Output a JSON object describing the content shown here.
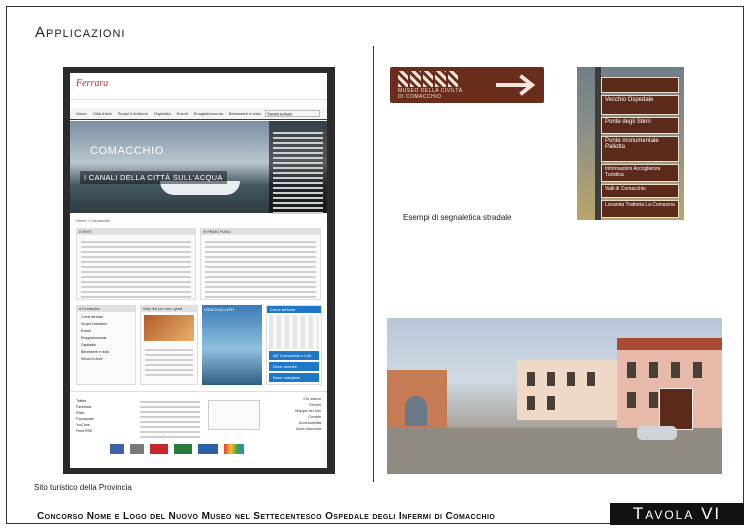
{
  "section_title": "Applicazioni",
  "captions": {
    "left": "Sito turistico della Provincia",
    "right": "Esempi di segnaletica stradale"
  },
  "footer": {
    "competition": "Concorso Nome e Logo del Nuovo Museo nel Settecentesco Ospedale degli Infermi di Comacchio",
    "board": "Tavola VI"
  },
  "sign_brown": {
    "text_line1": "MUSEO DELLA CIVILTÀ",
    "text_line2": "DI COMACCHIO"
  },
  "street_signs": [
    "Vecchio Ospedale",
    "Ponte degli Sbirri",
    "Ponte monumentale Pallotta",
    "Informazioni Accoglienza Turistica",
    "Valli di Comacchio",
    "Locanda Trattoria La Comacina"
  ],
  "website": {
    "logo": "Ferrara",
    "nav": [
      "Home",
      "Città d'arte",
      "Scopri il territorio",
      "Ospitalità",
      "Eventi",
      "Enogastronomia",
      "Benessere e relax",
      "Servizi e Aree"
    ],
    "search_placeholder": "Cerca nel sito",
    "hero_title": "COMACCHIO",
    "hero_subtitle": "I CANALI DELLA CITTÀ SULL'ACQUA",
    "breadcrumb": "Home › Comacchio",
    "panel_left_title": "EVENTI",
    "panel_right_title": "IN PRIMO PIANO",
    "sidebar_title": "A Comacchio",
    "sidebar_items": [
      "Come arrivare",
      "Scopri il territorio",
      "Eventi",
      "Enogastronomia",
      "Ospitalità",
      "Benessere e relax",
      "Servizi e Aree"
    ],
    "card_title": "Sotto dal pon mes i gessi",
    "card_video": "VIDEOGALLERY",
    "contact_title": "Come arrivare",
    "buttons": [
      "IAT Comacchio e Lidi",
      "Dove dormire",
      "Dove mangiare"
    ],
    "footer_links": [
      "Chi siamo",
      "Servizi",
      "Mappa del sito",
      "Credits",
      "Accessibilità",
      "Area riservata"
    ],
    "social": [
      "Twitter",
      "Facebook",
      "Flickr",
      "Foursquare",
      "YouTube",
      "Feed RSS"
    ]
  }
}
